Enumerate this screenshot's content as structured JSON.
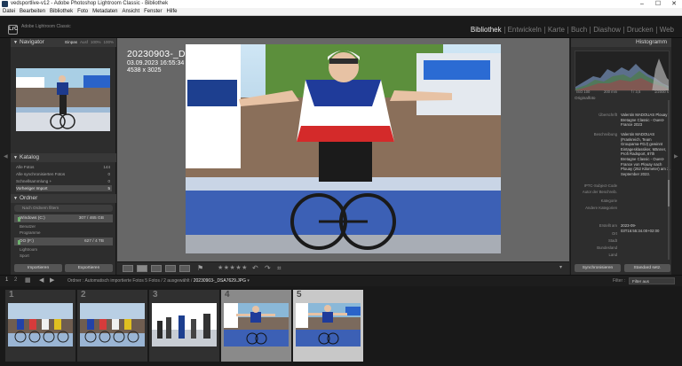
{
  "window": {
    "title": "vedsportlive-v12 - Adobe Photoshop Lightroom Classic - Bibliothek",
    "controls": [
      "–",
      "☐",
      "✕"
    ]
  },
  "menu": [
    "Datei",
    "Bearbeiten",
    "Bibliothek",
    "Foto",
    "Metadaten",
    "Ansicht",
    "Fenster",
    "Hilfe"
  ],
  "identity": {
    "logo": "LrC",
    "name": "Adobe Lightroom Classic"
  },
  "modules": [
    {
      "label": "Bibliothek",
      "active": true
    },
    {
      "label": "Entwickeln",
      "active": false
    },
    {
      "label": "Karte",
      "active": false
    },
    {
      "label": "Buch",
      "active": false
    },
    {
      "label": "Diashow",
      "active": false
    },
    {
      "label": "Drucken",
      "active": false
    },
    {
      "label": "Web",
      "active": false
    }
  ],
  "left": {
    "navigator": {
      "title": "Navigator",
      "options": [
        "Einpas",
        "Ausf",
        "100%",
        "100%"
      ]
    },
    "catalog": {
      "title": "Katalog",
      "items": [
        {
          "label": "Alle Fotos",
          "count": "144"
        },
        {
          "label": "Alle synchronisierten Fotos",
          "count": "0"
        },
        {
          "label": "Schnellsammlung +",
          "count": "0"
        },
        {
          "label": "Vorheriger Import",
          "count": "5"
        }
      ]
    },
    "folders": {
      "title": "Ordner",
      "search_placeholder": "Nach Ordnern filtern",
      "drives": [
        {
          "label": "Windows (C:)",
          "space": "307 / 465 GB",
          "subfolders": [
            "Benutzer",
            "Programme"
          ]
        },
        {
          "label": "DO (F:)",
          "space": "627 / 4 TB",
          "subfolders": [
            "Lightroom",
            "Sport",
            "2023"
          ]
        }
      ]
    },
    "buttons": {
      "import": "Importieren",
      "export": "Exportieren"
    }
  },
  "center": {
    "filename": "20230903-_DSA7629.JPG",
    "datetime": "03.09.2023 16:55:34",
    "dimensions": "4538 x 3025"
  },
  "toolbar": {
    "stars": "★★★★★"
  },
  "right": {
    "histogram": {
      "title": "Histogramm",
      "iso": "ISO 100",
      "focal": "200 mm",
      "aperture": "f / 3,5",
      "shutter": "1/2000 s"
    },
    "original_label": "Originalfoto",
    "metadata": [
      {
        "key": "Überschrift",
        "value": "Valentin MADOUAS Plouay Bretagne Classic - Ouest-France 2023"
      },
      {
        "key": "Beschreibung",
        "value": "Valentin MADOUAS (Frankreich, Team Groupama-FDJ) gewinnt Eintagesklassiker, Männer, Profi Radsport, 87th Bretagne Classic - Ouest-France von Plouay nach Plouay (252 Kilometer) am 3. September 2023."
      },
      {
        "key": "IPTC-Subject-Code",
        "value": ""
      },
      {
        "key": "Autor der Beschreib.",
        "value": ""
      },
      {
        "key": "Kategorie",
        "value": ""
      },
      {
        "key": "Andere Kategorien",
        "value": ""
      },
      {
        "key": "Erstellt am",
        "value": "2023-09-03T16:55:34.00+02:00"
      },
      {
        "key": "Ort",
        "value": ""
      },
      {
        "key": "Stadt",
        "value": ""
      },
      {
        "key": "Bundesland",
        "value": ""
      },
      {
        "key": "Land",
        "value": ""
      }
    ],
    "buttons": {
      "sync": "Synchronisieren",
      "defaults": "Standard setz."
    }
  },
  "filmstrip": {
    "pages": [
      "1",
      "2"
    ],
    "path_prefix": "Ordner : Automatisch importierte Fotos",
    "path_counts": "5 Fotos / 2 ausgewählt /",
    "path_file": "20230903-_DSA7629.JPG",
    "filter_label": "Filter :",
    "filter_value": "Filter aus",
    "cells": [
      {
        "num": "1",
        "state": "normal"
      },
      {
        "num": "2",
        "state": "normal"
      },
      {
        "num": "3",
        "state": "normal"
      },
      {
        "num": "4",
        "state": "selected"
      },
      {
        "num": "5",
        "state": "active"
      }
    ]
  },
  "colors": {
    "accent": "#e9e9e9",
    "panel": "#2d2d2d",
    "background": "#676767",
    "sky": "#8ab8d8"
  }
}
